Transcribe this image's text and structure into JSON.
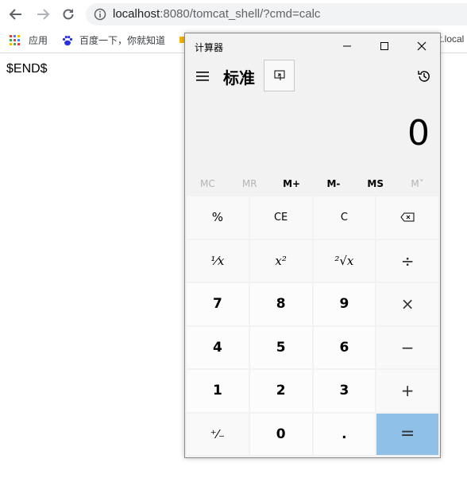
{
  "browser": {
    "url_host": "localhost",
    "url_rest": ":8080/tomcat_shell/?cmd=calc",
    "bookmarks": [
      {
        "label": "应用"
      },
      {
        "label": "百度一下，你就知道"
      },
      {
        "label": "t.local"
      }
    ],
    "accent_color": "#5f6368"
  },
  "page": {
    "body_text": "$END$"
  },
  "calculator": {
    "window_title": "计算器",
    "mode_title": "标准",
    "display_value": "0",
    "memory_buttons": [
      {
        "label": "MC",
        "enabled": false
      },
      {
        "label": "MR",
        "enabled": false
      },
      {
        "label": "M+",
        "enabled": true
      },
      {
        "label": "M-",
        "enabled": true
      },
      {
        "label": "MS",
        "enabled": true
      },
      {
        "label": "M˅",
        "enabled": false
      }
    ],
    "keys": {
      "percent": "%",
      "ce": "CE",
      "c": "C",
      "backspace": "⌫",
      "reciprocal": "¹⁄x",
      "square": "x²",
      "sqrt": "²√x",
      "divide": "÷",
      "n7": "7",
      "n8": "8",
      "n9": "9",
      "multiply": "×",
      "n4": "4",
      "n5": "5",
      "n6": "6",
      "minus": "−",
      "n1": "1",
      "n2": "2",
      "n3": "3",
      "plus": "+",
      "negate": "⁺⁄₋",
      "n0": "0",
      "decimal": ".",
      "equals": "="
    },
    "equals_color": "#8fc1e8"
  }
}
